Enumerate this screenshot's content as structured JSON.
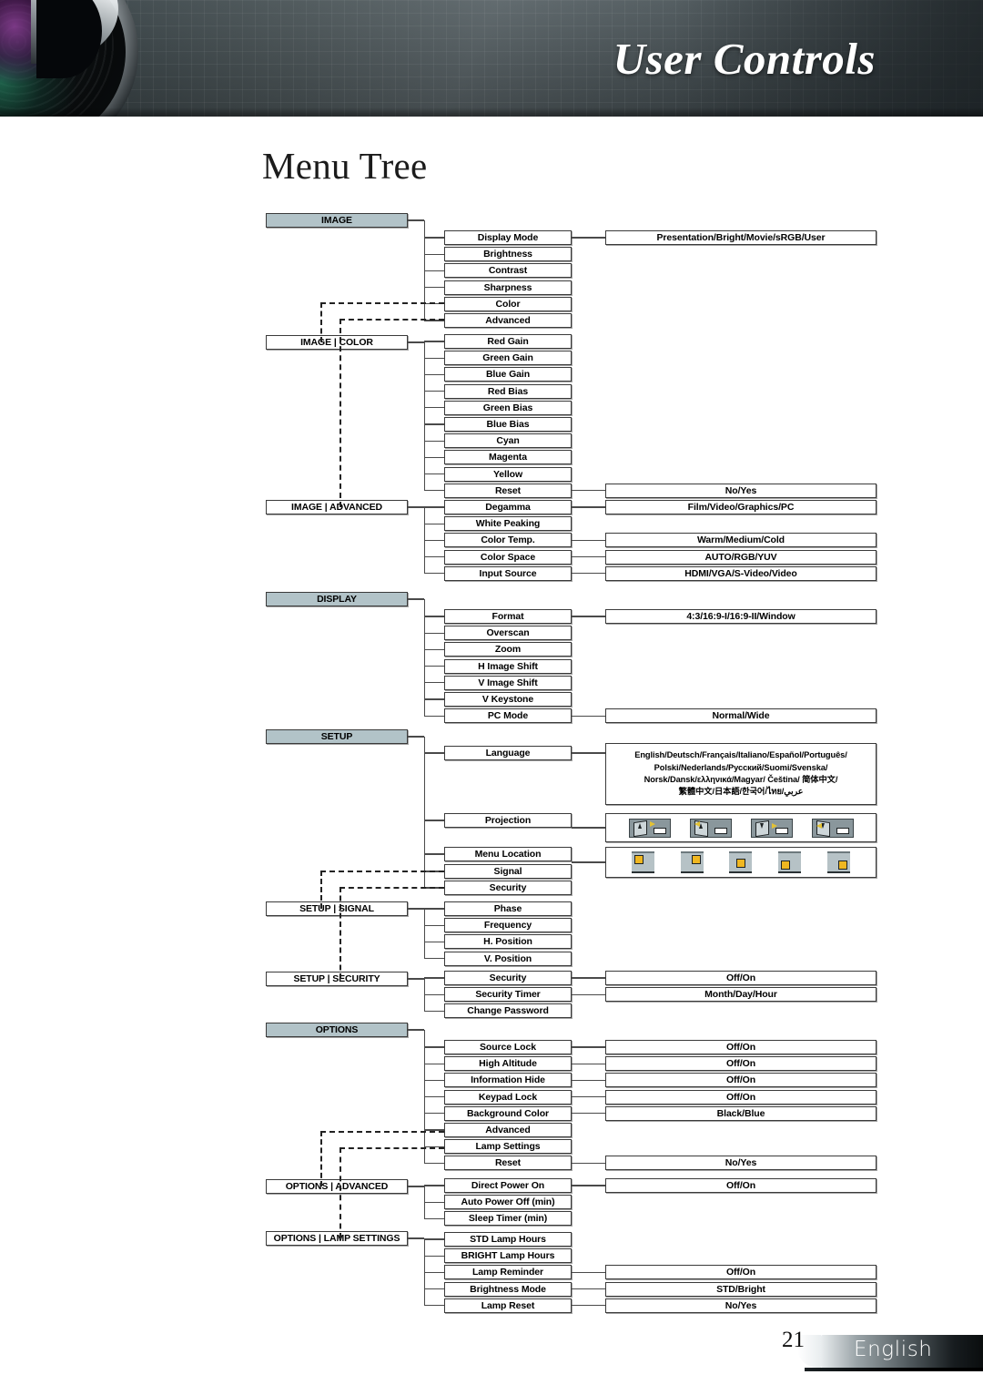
{
  "header": {
    "title": "User Controls",
    "lens_icon": "camera-lens-icon"
  },
  "page": {
    "title": "Menu Tree",
    "page_number": "21",
    "language_label": "English"
  },
  "tree": {
    "groups": [
      {
        "id": "image",
        "category": "IMAGE",
        "category_filled": true,
        "items": [
          {
            "label": "Display Mode",
            "value": "Presentation/Bright/Movie/sRGB/User"
          },
          {
            "label": "Brightness",
            "value": ""
          },
          {
            "label": "Contrast",
            "value": ""
          },
          {
            "label": "Sharpness",
            "value": ""
          },
          {
            "label": "Color",
            "value": ""
          },
          {
            "label": "Advanced",
            "value": ""
          }
        ]
      },
      {
        "id": "image-color",
        "category": "IMAGE | COLOR",
        "category_filled": false,
        "items": [
          {
            "label": "Red Gain",
            "value": ""
          },
          {
            "label": "Green Gain",
            "value": ""
          },
          {
            "label": "Blue Gain",
            "value": ""
          },
          {
            "label": "Red Bias",
            "value": ""
          },
          {
            "label": "Green Bias",
            "value": ""
          },
          {
            "label": "Blue Bias",
            "value": ""
          },
          {
            "label": "Cyan",
            "value": ""
          },
          {
            "label": "Magenta",
            "value": ""
          },
          {
            "label": "Yellow",
            "value": ""
          },
          {
            "label": "Reset",
            "value": "No/Yes"
          }
        ]
      },
      {
        "id": "image-advanced",
        "category": "IMAGE | ADVANCED",
        "category_filled": false,
        "items": [
          {
            "label": "Degamma",
            "value": "Film/Video/Graphics/PC"
          },
          {
            "label": "White Peaking",
            "value": ""
          },
          {
            "label": "Color Temp.",
            "value": "Warm/Medium/Cold"
          },
          {
            "label": "Color Space",
            "value": "AUTO/RGB/YUV"
          },
          {
            "label": "Input Source",
            "value": "HDMI/VGA/S-Video/Video"
          }
        ]
      },
      {
        "id": "display",
        "category": "DISPLAY",
        "category_filled": true,
        "items": [
          {
            "label": "Format",
            "value": "4:3/16:9-I/16:9-II/Window"
          },
          {
            "label": "Overscan",
            "value": ""
          },
          {
            "label": "Zoom",
            "value": ""
          },
          {
            "label": "H Image Shift",
            "value": ""
          },
          {
            "label": "V Image Shift",
            "value": ""
          },
          {
            "label": "V Keystone",
            "value": ""
          },
          {
            "label": "PC Mode",
            "value": "Normal/Wide"
          }
        ]
      },
      {
        "id": "setup",
        "category": "SETUP",
        "category_filled": true,
        "items": [
          {
            "label": "Language",
            "value": ""
          },
          {
            "label": "Projection",
            "value": ""
          },
          {
            "label": "Menu Location",
            "value": ""
          },
          {
            "label": "Signal",
            "value": ""
          },
          {
            "label": "Security",
            "value": ""
          }
        ]
      },
      {
        "id": "setup-signal",
        "category": "SETUP | SIGNAL",
        "category_filled": false,
        "items": [
          {
            "label": "Phase",
            "value": ""
          },
          {
            "label": "Frequency",
            "value": ""
          },
          {
            "label": "H. Position",
            "value": ""
          },
          {
            "label": "V. Position",
            "value": ""
          }
        ]
      },
      {
        "id": "setup-security",
        "category": "SETUP | SECURITY",
        "category_filled": false,
        "items": [
          {
            "label": "Security",
            "value": "Off/On"
          },
          {
            "label": "Security Timer",
            "value": "Month/Day/Hour"
          },
          {
            "label": "Change Password",
            "value": ""
          }
        ]
      },
      {
        "id": "options",
        "category": "OPTIONS",
        "category_filled": true,
        "items": [
          {
            "label": "Source Lock",
            "value": "Off/On"
          },
          {
            "label": "High Altitude",
            "value": "Off/On"
          },
          {
            "label": "Information Hide",
            "value": "Off/On"
          },
          {
            "label": "Keypad Lock",
            "value": "Off/On"
          },
          {
            "label": "Background Color",
            "value": "Black/Blue"
          },
          {
            "label": "Advanced",
            "value": ""
          },
          {
            "label": "Lamp Settings",
            "value": ""
          },
          {
            "label": "Reset",
            "value": "No/Yes"
          }
        ]
      },
      {
        "id": "options-advanced",
        "category": "OPTIONS | ADVANCED",
        "category_filled": false,
        "items": [
          {
            "label": "Direct Power On",
            "value": "Off/On"
          },
          {
            "label": "Auto Power Off (min)",
            "value": ""
          },
          {
            "label": "Sleep Timer (min)",
            "value": ""
          }
        ]
      },
      {
        "id": "options-lamp-settings",
        "category": "OPTIONS | LAMP SETTINGS",
        "category_filled": false,
        "items": [
          {
            "label": "STD Lamp Hours",
            "value": ""
          },
          {
            "label": "BRIGHT Lamp Hours",
            "value": ""
          },
          {
            "label": "Lamp Reminder",
            "value": "Off/On"
          },
          {
            "label": "Brightness Mode",
            "value": "STD/Bright"
          },
          {
            "label": "Lamp Reset",
            "value": "No/Yes"
          }
        ]
      }
    ],
    "language_options": {
      "line1": "English/Deutsch/Français/Italiano/Español/Português/",
      "line2": "Polski/Nederlands/Русский/Suomi/Svenska/",
      "line3": "Norsk/Dansk/ελληνικά/Magyar/ Čeština/ 简体中文/",
      "line4": "繁體中文/日本語/한국어/ไทย/عربي"
    },
    "projection_icons": [
      "projection-front-table-icon",
      "projection-rear-table-icon",
      "projection-front-ceiling-icon",
      "projection-rear-ceiling-icon"
    ],
    "menu_location_icons": [
      "menu-location-top-left-icon",
      "menu-location-top-right-icon",
      "menu-location-center-icon",
      "menu-location-bottom-left-icon",
      "menu-location-bottom-right-icon"
    ]
  },
  "colors": {
    "category_fill": "#b2c3c8",
    "box_border": "#3a3a3a",
    "header_dark": "#3a4448",
    "accent_yellow": "#f0b721"
  }
}
